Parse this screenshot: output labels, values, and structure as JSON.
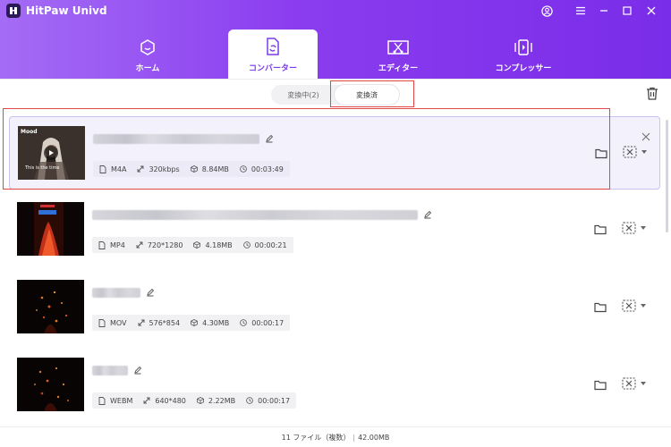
{
  "app": {
    "title": "HitPaw Univd"
  },
  "nav": {
    "tabs": [
      {
        "label": "ホーム",
        "icon": "home-icon"
      },
      {
        "label": "コンバーター",
        "icon": "converter-icon",
        "active": true
      },
      {
        "label": "エディター",
        "icon": "editor-icon"
      },
      {
        "label": "コンプレッサー",
        "icon": "compressor-icon"
      }
    ]
  },
  "subtabs": {
    "processing": "変換中(2)",
    "done": "変換済"
  },
  "files": [
    {
      "format": "M4A",
      "resolution": "320kbps",
      "size": "8.84MB",
      "duration": "00:03:49",
      "thumb_text_top": "Mood",
      "thumb_text_bottom": "This is the time"
    },
    {
      "format": "MP4",
      "resolution": "720*1280",
      "size": "4.18MB",
      "duration": "00:00:21"
    },
    {
      "format": "MOV",
      "resolution": "576*854",
      "size": "4.30MB",
      "duration": "00:00:17"
    },
    {
      "format": "WEBM",
      "resolution": "640*480",
      "size": "2.22MB",
      "duration": "00:00:17"
    }
  ],
  "status": {
    "count": "11 ファイル（複数）",
    "total": "42.00MB"
  },
  "colors": {
    "accent": "#7a3be8",
    "highlight": "#e04848"
  }
}
